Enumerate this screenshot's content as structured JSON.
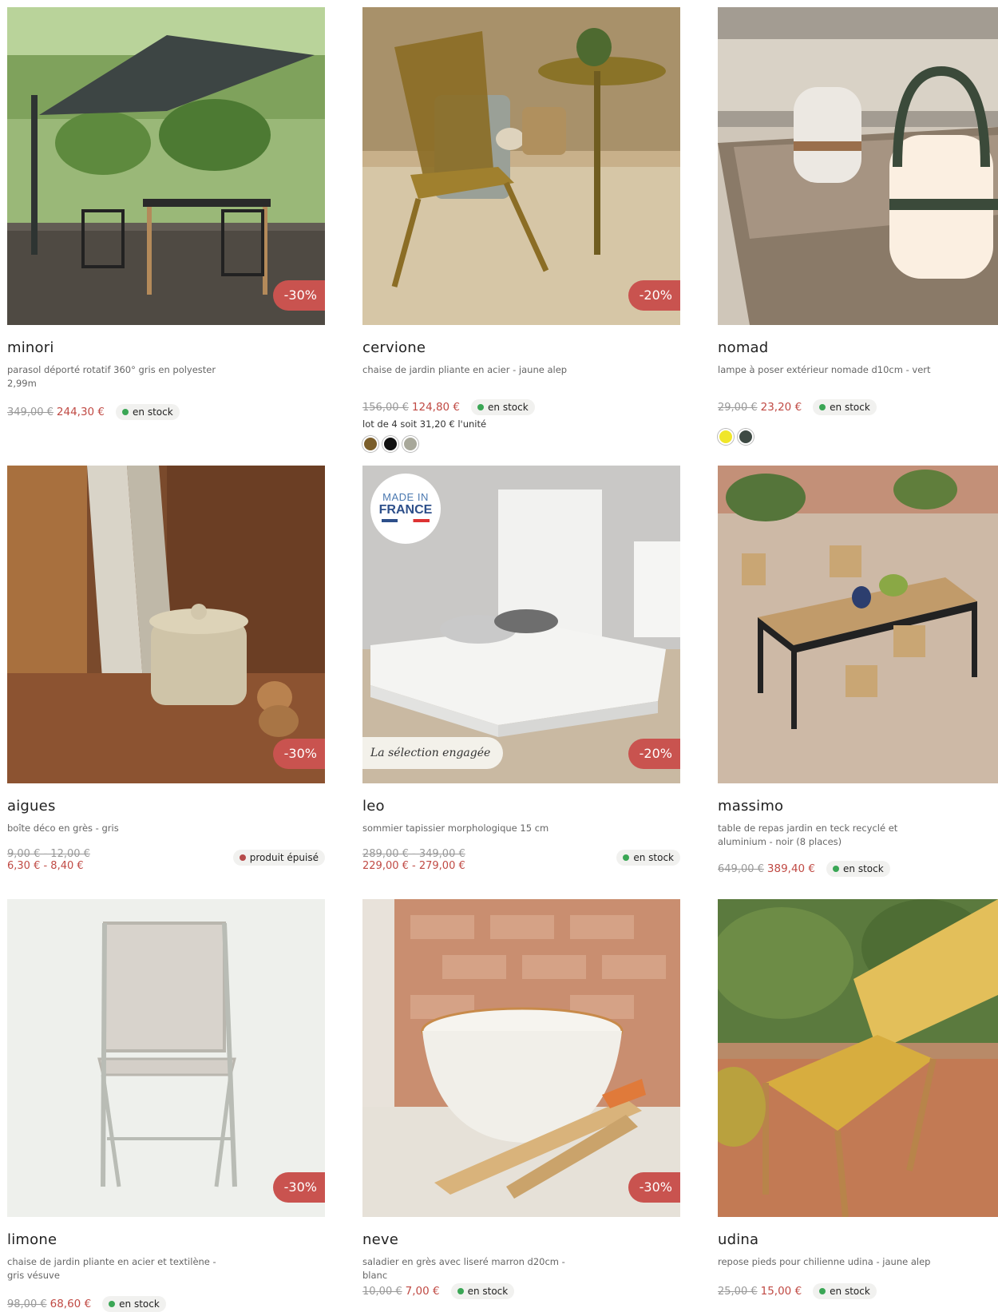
{
  "products": [
    {
      "name": "minori",
      "desc": "parasol déporté rotatif 360° gris en polyester 2,99m",
      "old": "349,00 €",
      "new": "244,30 €",
      "discount": "-30%",
      "stock": "en stock"
    },
    {
      "name": "cervione",
      "desc": "chaise de jardin pliante en acier - jaune alep",
      "old": "156,00 €",
      "new": "124,80 €",
      "discount": "-20%",
      "stock": "en stock",
      "lot": "lot de 4 soit 31,20 € l'unité",
      "swatches": [
        "#7b5e2a",
        "#111111",
        "#a8a89a"
      ]
    },
    {
      "name": "nomad",
      "desc": "lampe à poser extérieur nomade d10cm - vert",
      "old": "29,00 €",
      "new": "23,20 €",
      "stock": "en stock",
      "swatches": [
        "#f0e62a",
        "#3e4a44"
      ]
    },
    {
      "name": "aigues",
      "desc": "boîte déco en grès - gris",
      "old": "9,00 € - 12,00 €",
      "new": "6,30 € - 8,40 €",
      "discount": "-30%",
      "stock": "produit épuisé"
    },
    {
      "name": "leo",
      "desc": "sommier tapissier morphologique 15 cm",
      "old": "289,00 € - 349,00 €",
      "new": "229,00 € - 279,00 €",
      "discount": "-20%",
      "stock": "en stock",
      "made_in": [
        "MADE IN",
        "FRANCE"
      ],
      "selection": "La sélection engagée"
    },
    {
      "name": "massimo",
      "desc": "table de repas jardin en teck recyclé et aluminium - noir (8 places)",
      "old": "649,00 €",
      "new": "389,40 €",
      "stock": "en stock"
    },
    {
      "name": "limone",
      "desc": "chaise de jardin pliante en acier et textilène - gris vésuve",
      "old": "98,00 €",
      "new": "68,60 €",
      "discount": "-30%",
      "stock": "en stock"
    },
    {
      "name": "neve",
      "desc": "saladier en grès avec liseré marron d20cm - blanc",
      "old": "10,00 €",
      "new": "7,00 €",
      "discount": "-30%",
      "stock": "en stock"
    },
    {
      "name": "udina",
      "desc": "repose pieds pour chilienne udina - jaune alep",
      "old": "25,00 €",
      "new": "15,00 €",
      "stock": "en stock"
    }
  ],
  "colors": {
    "discount_badge": "#c9534f",
    "price_new": "#c04a44",
    "stock_dot": "#3aa655",
    "soldout_dot": "#b54a4a"
  },
  "icons": {
    "stock": "green-dot-icon",
    "soldout": "red-dot-icon"
  }
}
